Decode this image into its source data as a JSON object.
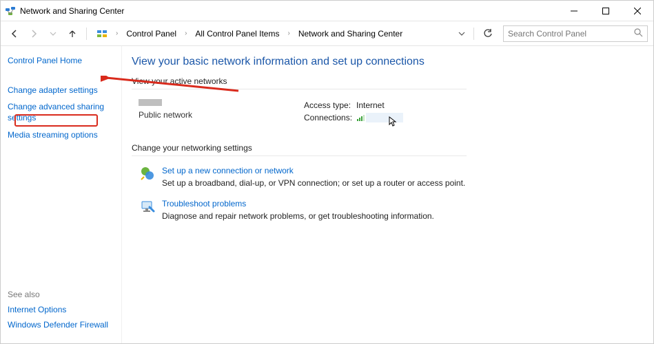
{
  "window": {
    "title": "Network and Sharing Center"
  },
  "nav": {
    "breadcrumb": [
      "Control Panel",
      "All Control Panel Items",
      "Network and Sharing Center"
    ],
    "search_placeholder": "Search Control Panel"
  },
  "sidebar": {
    "home": "Control Panel Home",
    "links": [
      "Change adapter settings",
      "Change advanced sharing settings",
      "Media streaming options"
    ],
    "see_also_title": "See also",
    "see_also": [
      "Internet Options",
      "Windows Defender Firewall"
    ]
  },
  "content": {
    "page_title": "View your basic network information and set up connections",
    "active_section": "View your active networks",
    "network_type": "Public network",
    "access_label": "Access type:",
    "access_value": "Internet",
    "connections_label": "Connections:",
    "change_section": "Change your networking settings",
    "options": [
      {
        "title": "Set up a new connection or network",
        "desc": "Set up a broadband, dial-up, or VPN connection; or set up a router or access point."
      },
      {
        "title": "Troubleshoot problems",
        "desc": "Diagnose and repair network problems, or get troubleshooting information."
      }
    ]
  }
}
